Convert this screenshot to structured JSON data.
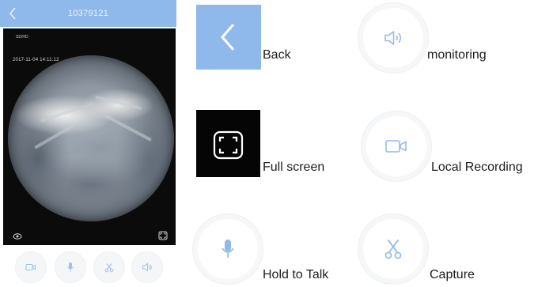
{
  "phone": {
    "title": "10379121",
    "resolution": "SD/HD",
    "timestamp": "2017-11-04  14:11:12",
    "bottom_bar_icons": [
      "video-camera-icon",
      "microphone-icon",
      "scissors-icon",
      "speaker-icon"
    ]
  },
  "legend": {
    "back": {
      "label": "Back",
      "icon": "chevron-left-icon"
    },
    "monitoring": {
      "label": "monitoring",
      "icon": "speaker-icon"
    },
    "full_screen": {
      "label": "Full screen",
      "icon": "fullscreen-icon"
    },
    "local_recording": {
      "label": "Local Recording",
      "icon": "video-camera-icon"
    },
    "hold_to_talk": {
      "label": "Hold to Talk",
      "icon": "microphone-icon"
    },
    "capture": {
      "label": "Capture",
      "icon": "scissors-icon"
    }
  },
  "colors": {
    "accent_blue": "#8fb9ea",
    "icon_blue": "#8fb9ea",
    "video_background": "#0b0b0b"
  }
}
